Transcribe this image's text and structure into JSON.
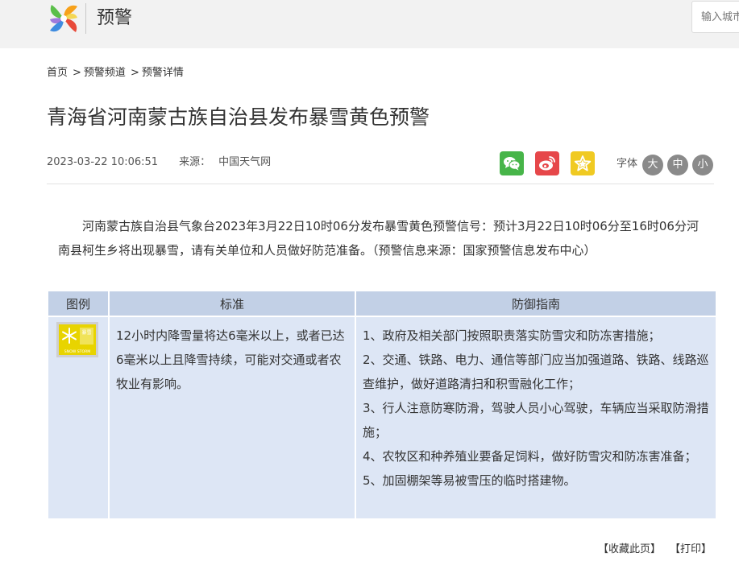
{
  "header": {
    "site_name": "预警",
    "search_placeholder": "输入城市"
  },
  "breadcrumb": {
    "home": "首页",
    "channel": "预警频道",
    "detail": "预警详情",
    "separator": ">"
  },
  "article": {
    "title": "青海省河南蒙古族自治县发布暴雪黄色预警",
    "datetime": "2023-03-22 10:06:51",
    "source_label": "来源：",
    "source_value": "中国天气网",
    "body": "河南蒙古族自治县气象台2023年3月22日10时06分发布暴雪黄色预警信号：预计3月22日10时06分至16时06分河南县柯生乡将出现暴雪，请有关单位和人员做好防范准备。（预警信息来源：国家预警信息发布中心）"
  },
  "share": {
    "icons": [
      "wechat-icon",
      "weibo-icon",
      "favorite-star-icon"
    ],
    "colors": {
      "wechat": "#47b549",
      "weibo": "#e6474a",
      "favorite": "#f0ca22"
    }
  },
  "font_size": {
    "label": "字体",
    "big": "大",
    "medium": "中",
    "small": "小"
  },
  "table": {
    "headers": {
      "icon": "图例",
      "standard": "标准",
      "guide": "防御指南"
    },
    "standard_text": "12小时内降雪量将达6毫米以上，或者已达6毫米以上且降雪持续，可能对交通或者农牧业有影响。",
    "guide": [
      "1、政府及相关部门按照职责落实防雪灾和防冻害措施；",
      "2、交通、铁路、电力、通信等部门应当加强道路、铁路、线路巡查维护，做好道路清扫和积雪融化工作；",
      "3、行人注意防寒防滑，驾驶人员小心驾驶，车辆应当采取防滑措施；",
      "4、农牧区和种养殖业要备足饲料，做好防雪灾和防冻害准备；",
      "5、加固棚架等易被雪压的临时搭建物。"
    ],
    "sign": {
      "icon": "snowstorm-yellow-warning-icon",
      "text_top": "暴雪",
      "text_bottom": "SNOW STORM",
      "color": "#e8d400"
    }
  },
  "footer": {
    "collect": "【收藏此页】",
    "print": "【打印】"
  }
}
